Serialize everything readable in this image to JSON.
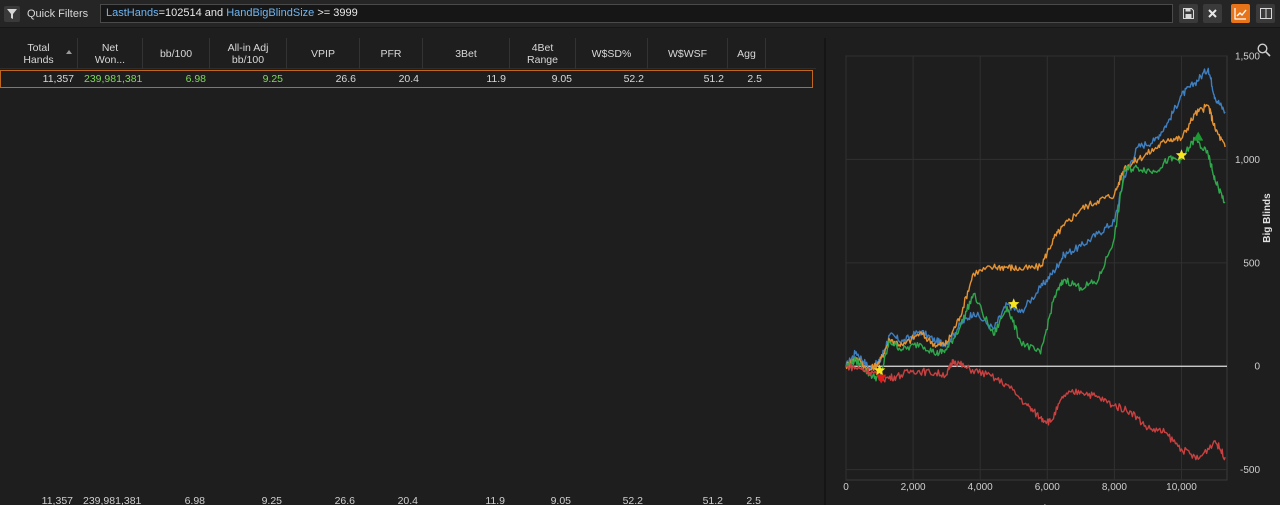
{
  "filter_bar": {
    "quick_filters_label": "Quick Filters",
    "query": [
      {
        "t": "LastHands",
        "k": "field"
      },
      {
        "t": "=102514 ",
        "k": "text"
      },
      {
        "t": "and ",
        "k": "kw"
      },
      {
        "t": "HandBigBlindSize",
        "k": "field"
      },
      {
        "t": " >= ",
        "k": "kw"
      },
      {
        "t": "3999",
        "k": "text"
      }
    ]
  },
  "table": {
    "columns": [
      {
        "key": "total_hands",
        "label": "Total\nHands",
        "sorted": true
      },
      {
        "key": "net_won",
        "label": "Net\nWon..."
      },
      {
        "key": "bb100",
        "label": "bb/100"
      },
      {
        "key": "allin_bb100",
        "label": "All-in Adj\nbb/100"
      },
      {
        "key": "vpip",
        "label": "VPIP"
      },
      {
        "key": "pfr",
        "label": "PFR"
      },
      {
        "key": "3bet",
        "label": "3Bet"
      },
      {
        "key": "4bet",
        "label": "4Bet\nRange"
      },
      {
        "key": "wsd",
        "label": "W$SD%"
      },
      {
        "key": "wwsf",
        "label": "W$WSF"
      },
      {
        "key": "agg",
        "label": "Agg"
      }
    ],
    "row": [
      "11,357",
      "239,981,381",
      "6.98",
      "9.25",
      "26.6",
      "20.4",
      "11.9",
      "9.05",
      "52.2",
      "51.2",
      "2.5"
    ],
    "totals": [
      "11,357",
      "239,981,381",
      "6.98",
      "9.25",
      "26.6",
      "20.4",
      "11.9",
      "9.05",
      "52.2",
      "51.2",
      "2.5"
    ]
  },
  "graph": {
    "y_axis_label": "Big Blinds",
    "x_axis_label": "Hands"
  },
  "chart_data": {
    "type": "line",
    "xlabel": "Hands",
    "ylabel": "Big Blinds",
    "xlim": [
      0,
      11357
    ],
    "ylim": [
      -550,
      1500
    ],
    "x_ticks": [
      0,
      2000,
      4000,
      6000,
      8000,
      10000
    ],
    "x_tick_labels": [
      "0",
      "2,000",
      "4,000",
      "6,000",
      "8,000",
      "10,000"
    ],
    "y_ticks": [
      -500,
      0,
      500,
      1000,
      1500
    ],
    "y_tick_labels": [
      "-500",
      "0",
      "500",
      "1,000",
      "1,500"
    ],
    "grid": true,
    "series": [
      {
        "color": "#3f7fc0",
        "x": [
          0,
          300,
          700,
          1000,
          1300,
          1700,
          2200,
          2700,
          3000,
          3400,
          3800,
          4400,
          4800,
          5200,
          5800,
          6200,
          6500,
          7000,
          7500,
          8000,
          8300,
          8700,
          9200,
          9600,
          10000,
          10400,
          10800,
          11000,
          11300
        ],
        "values": [
          0,
          70,
          -10,
          20,
          150,
          120,
          170,
          120,
          110,
          200,
          260,
          180,
          300,
          260,
          380,
          460,
          540,
          580,
          640,
          700,
          920,
          1060,
          1090,
          1180,
          1310,
          1370,
          1440,
          1300,
          1230
        ]
      },
      {
        "color": "#e39234",
        "x": [
          0,
          300,
          700,
          1000,
          1300,
          1700,
          2200,
          2700,
          3000,
          3400,
          3800,
          4400,
          4800,
          5200,
          5800,
          6200,
          6500,
          7000,
          7500,
          8000,
          8300,
          8700,
          9200,
          9600,
          10000,
          10400,
          10800,
          11000,
          11300
        ],
        "values": [
          0,
          40,
          -20,
          20,
          130,
          100,
          160,
          100,
          110,
          240,
          450,
          480,
          480,
          470,
          480,
          620,
          680,
          760,
          800,
          830,
          960,
          1000,
          1050,
          1100,
          1100,
          1220,
          1260,
          1150,
          1060
        ]
      },
      {
        "color": "#2ea84a",
        "x": [
          0,
          300,
          700,
          1000,
          1300,
          1700,
          2200,
          2700,
          3000,
          3400,
          3800,
          4400,
          4800,
          5200,
          5800,
          6200,
          6500,
          7000,
          7500,
          8000,
          8300,
          8700,
          9200,
          9600,
          10000,
          10400,
          10800,
          11000,
          11300
        ],
        "values": [
          0,
          30,
          -40,
          -60,
          120,
          80,
          110,
          60,
          80,
          190,
          350,
          150,
          290,
          120,
          60,
          330,
          420,
          380,
          410,
          620,
          950,
          960,
          940,
          1000,
          1000,
          1100,
          1020,
          900,
          790
        ]
      },
      {
        "color": "#c94040",
        "x": [
          0,
          400,
          800,
          1100,
          1500,
          2000,
          2500,
          3000,
          3200,
          3600,
          4200,
          4800,
          5400,
          5800,
          6100,
          6500,
          7000,
          7500,
          8000,
          8500,
          9000,
          9500,
          10000,
          10500,
          11000,
          11300
        ],
        "values": [
          0,
          -10,
          -30,
          -60,
          -50,
          -20,
          -30,
          -40,
          30,
          -10,
          -40,
          -90,
          -190,
          -250,
          -270,
          -140,
          -120,
          -150,
          -190,
          -220,
          -300,
          -320,
          -400,
          -450,
          -360,
          -440
        ]
      }
    ],
    "markers": [
      {
        "shape": "star",
        "color": "#f7e51f",
        "x": 1000,
        "y": -20
      },
      {
        "shape": "star",
        "color": "#f7e51f",
        "x": 5000,
        "y": 300
      },
      {
        "shape": "star",
        "color": "#f7e51f",
        "x": 10000,
        "y": 1020
      },
      {
        "shape": "triangle-down",
        "color": "#e11a1a",
        "x": 1050,
        "y": -60
      },
      {
        "shape": "triangle-up",
        "color": "#1c9a32",
        "x": 10500,
        "y": 1110
      }
    ]
  },
  "icons": {
    "filter": "funnel-icon",
    "save": "save-icon",
    "clear": "close-icon",
    "graph": "line-chart-icon",
    "layout": "split-panel-icon",
    "zoom": "magnifier-icon"
  }
}
